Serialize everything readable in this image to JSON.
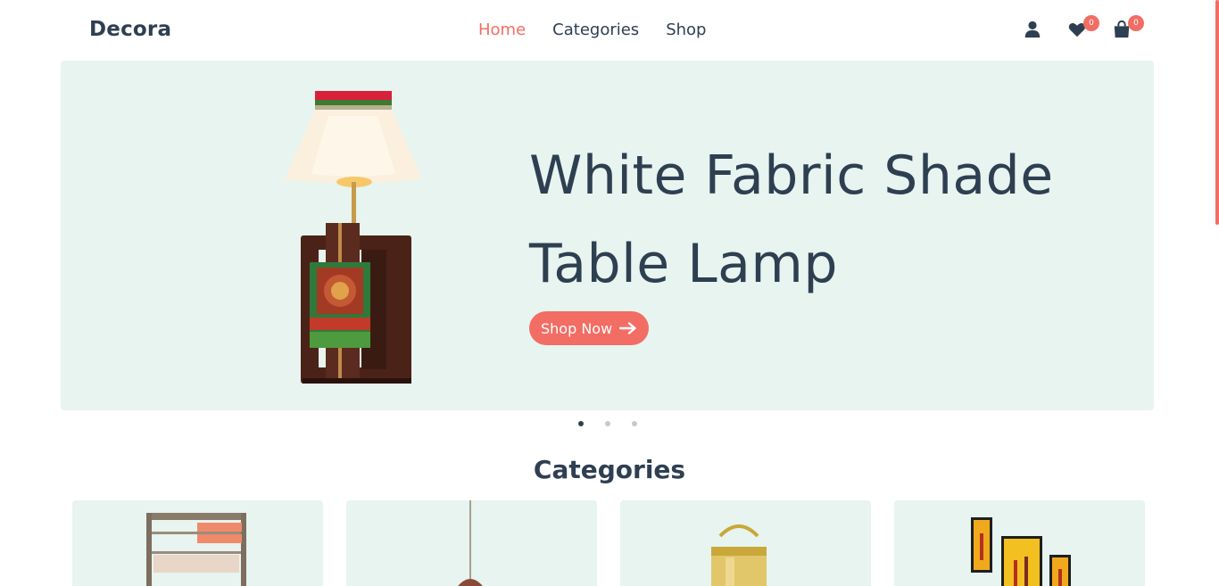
{
  "header": {
    "logo": "Decora",
    "nav": [
      {
        "label": "Home",
        "active": true
      },
      {
        "label": "Categories",
        "active": false
      },
      {
        "label": "Shop",
        "active": false
      }
    ],
    "icons": {
      "account": "user-icon",
      "wishlist": "heart-icon",
      "cart": "shopping-bag-icon"
    },
    "wishlist_count": "0",
    "cart_count": "0"
  },
  "hero": {
    "title_line1": "White Fabric Shade",
    "title_line2": "Table Lamp",
    "button_label": "Shop Now",
    "button_icon": "arrow-right-icon",
    "slides": 3,
    "active_slide": 1
  },
  "categories": {
    "title": "Categories",
    "cards": [
      "shelf-image",
      "pendant-lamp-image",
      "brass-bucket-image",
      "wall-art-image"
    ]
  },
  "colors": {
    "accent": "#f26d64",
    "text": "#2f3f52",
    "panel": "#e7f4ef"
  }
}
